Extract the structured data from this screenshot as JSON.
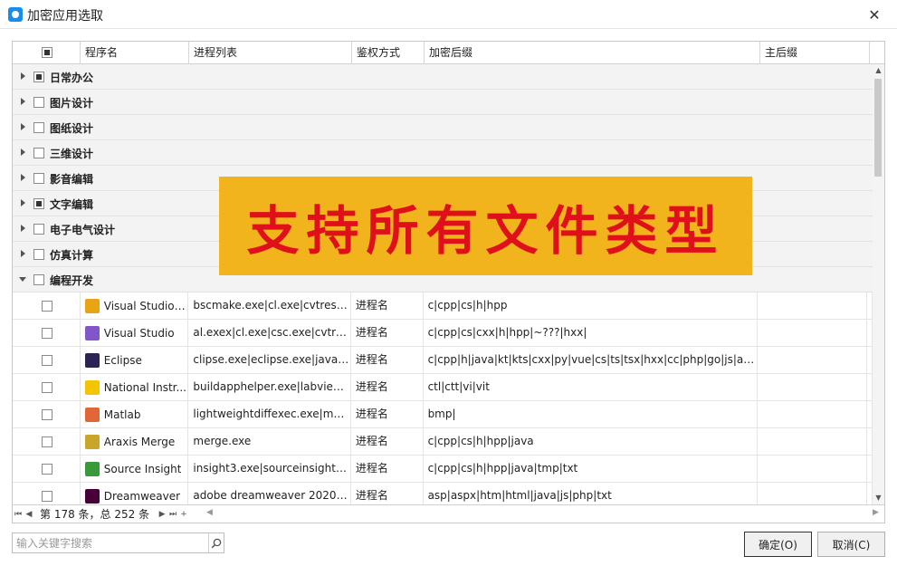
{
  "window": {
    "title": "加密应用选取",
    "close_symbol": "✕"
  },
  "table": {
    "columns": [
      "程序名",
      "进程列表",
      "鉴权方式",
      "加密后缀",
      "主后缀"
    ],
    "groups": [
      {
        "label": "日常办公",
        "checked": "partial",
        "expanded": false
      },
      {
        "label": "图片设计",
        "checked": "none",
        "expanded": false
      },
      {
        "label": "图纸设计",
        "checked": "none",
        "expanded": false
      },
      {
        "label": "三维设计",
        "checked": "none",
        "expanded": false
      },
      {
        "label": "影音编辑",
        "checked": "none",
        "expanded": false
      },
      {
        "label": "文字编辑",
        "checked": "partial",
        "expanded": false
      },
      {
        "label": "电子电气设计",
        "checked": "none",
        "expanded": false
      },
      {
        "label": "仿真计算",
        "checked": "none",
        "expanded": false
      },
      {
        "label": "编程开发",
        "checked": "none",
        "expanded": true
      }
    ],
    "rows": [
      {
        "icon": "visual-studio-code-icon",
        "icon_color": "#e8a317",
        "name": "Visual Studio ...",
        "processes": "bscmake.exe|cl.exe|cvtres.e...",
        "auth": "进程名",
        "suffixes": "c|cpp|cs|h|hpp",
        "main_suffix": ""
      },
      {
        "icon": "visual-studio-icon",
        "icon_color": "#7f57c8",
        "name": "Visual Studio",
        "processes": "al.exex|cl.exe|csc.exe|cvtres...",
        "auth": "进程名",
        "suffixes": "c|cpp|cs|cxx|h|hpp|~???|hxx|",
        "main_suffix": ""
      },
      {
        "icon": "eclipse-icon",
        "icon_color": "#2c2255",
        "name": "Eclipse",
        "processes": "clipse.exe|eclipse.exe|javac...",
        "auth": "进程名",
        "suffixes": "c|cpp|h|java|kt|kts|cxx|py|vue|cs|ts|tsx|hxx|cc|php|go|js|asp|jsp|",
        "main_suffix": ""
      },
      {
        "icon": "national-instruments-icon",
        "icon_color": "#f5c400",
        "name": "National Instr...",
        "processes": "buildapphelper.exe|labview....",
        "auth": "进程名",
        "suffixes": "ctl|ctt|vi|vit",
        "main_suffix": ""
      },
      {
        "icon": "matlab-icon",
        "icon_color": "#e16737",
        "name": "Matlab",
        "processes": "lightweightdiffexec.exe|matl...",
        "auth": "进程名",
        "suffixes": "bmp|",
        "main_suffix": ""
      },
      {
        "icon": "araxis-merge-icon",
        "icon_color": "#c9a52a",
        "name": "Araxis Merge",
        "processes": "merge.exe",
        "auth": "进程名",
        "suffixes": "c|cpp|cs|h|hpp|java",
        "main_suffix": ""
      },
      {
        "icon": "source-insight-icon",
        "icon_color": "#3a9a3a",
        "name": "Source Insight",
        "processes": "insight3.exe|sourceinsight4....",
        "auth": "进程名",
        "suffixes": "c|cpp|cs|h|hpp|java|tmp|txt",
        "main_suffix": ""
      },
      {
        "icon": "dreamweaver-icon",
        "icon_color": "#470137",
        "name": "Dreamweaver",
        "processes": "adobe dreamweaver 2020.e...",
        "auth": "进程名",
        "suffixes": "asp|aspx|htm|html|java|js|php|txt",
        "main_suffix": ""
      }
    ]
  },
  "pager": {
    "text": "第 178 条，总 252 条"
  },
  "banner": {
    "text": "支持所有文件类型"
  },
  "search": {
    "placeholder": "输入关键字搜索",
    "value": ""
  },
  "buttons": {
    "ok": "确定(O)",
    "cancel": "取消(C)"
  },
  "colors": {
    "banner_bg": "#f2b41c",
    "banner_text": "#e0101a",
    "app_icon": "#1a8ceb"
  }
}
